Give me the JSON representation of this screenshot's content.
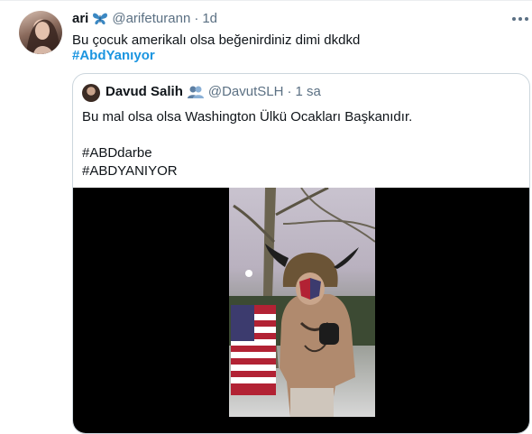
{
  "tweet": {
    "author_name": "ari",
    "author_emoji": "butterfly-icon",
    "handle": "@arifeturann",
    "separator": "·",
    "time": "1d",
    "text": "Bu çocuk amerikalı olsa beğenirdiniz dimi dkdkd",
    "hashtag": "#AbdYanıyor"
  },
  "quoted": {
    "author_name": "Davud Salih",
    "badge_icon": "people-icon",
    "handle": "@DavutSLH",
    "separator": "·",
    "time": "1 sa",
    "text": "Bu mal olsa olsa Washington Ülkü Ocakları Başkanıdır.",
    "tags": [
      "#ABDdarbe",
      "#ABDYANIYOR"
    ]
  },
  "colors": {
    "link": "#1b95e0",
    "secondary": "#5b7083",
    "border": "#ccd6dd",
    "media_bg": "#000000"
  }
}
